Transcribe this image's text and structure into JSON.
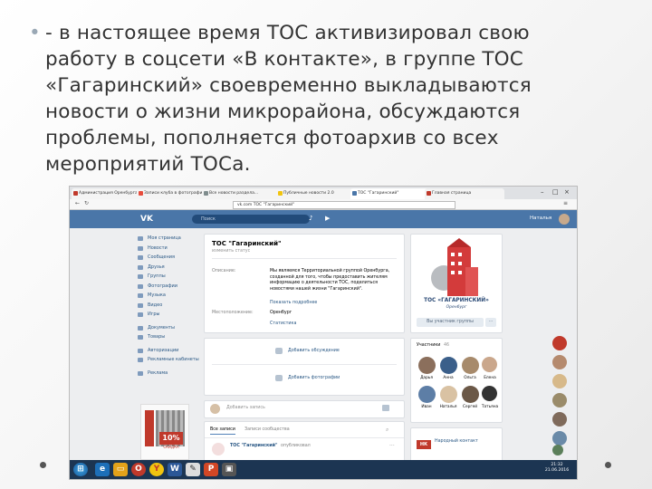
{
  "slide": {
    "bullet": "•",
    "text": "- в настоящее время ТОС активизировал свою работу в соцсети «В контакте», в группе ТОС «Гагаринский» своевременно выкладываются новости о жизни микрорайона, обсуждаются проблемы, пополняется фотоархив со всех мероприятий ТОСа."
  },
  "browser": {
    "tabs": [
      {
        "label": "Администрация Оренбурга",
        "color": "#c0392b"
      },
      {
        "label": "Записи клуба в фотографиях",
        "color": "#e74c3c"
      },
      {
        "label": "Все новости раздела...",
        "color": "#7f8c8d"
      },
      {
        "label": "Публичные новости 2.0",
        "color": "#f1c40f"
      },
      {
        "label": "ТОС \"Гагаринский\"",
        "color": "#4a76a8"
      },
      {
        "label": "Главная страница",
        "color": "#c0392b"
      }
    ],
    "address": "vk.com   ТОС \"Гагаринский\""
  },
  "vk": {
    "logo": "VK",
    "search_placeholder": "Поиск",
    "user_name": "Наталья",
    "nav": [
      "Моя страница",
      "Новости",
      "Сообщения",
      "Друзья",
      "Группы",
      "Фотографии",
      "Музыка",
      "Видео",
      "Игры",
      "",
      "Документы",
      "Товары",
      "",
      "Авторизации",
      "Рекламные кабинеты",
      "",
      "Реклама"
    ],
    "group_name": "ТОС \"Гагаринский\"",
    "group_status": "изменить статус",
    "info": [
      {
        "label": "Описание:",
        "value": "Мы являемся Территориальной группой Оренбурга, созданной для того, чтобы предоставить жителям информацию о деятельности ТОС, поделиться новостями нашей жизни \"Гагаринский\"."
      },
      {
        "label": "Местоположение:",
        "value": "Оренбург"
      }
    ],
    "more_link": "Показать подробнее",
    "stats_link": "Статистика",
    "add_discussion": "Добавить обсуждение",
    "add_photos": "Добавить фотографии",
    "members_title": "Участники",
    "members_count": "46",
    "member_names": [
      "Дарья",
      "Анна",
      "Ольга",
      "Елена",
      "Иван",
      "Наталья",
      "Сергей",
      "Татьяна"
    ],
    "invite_btn": "Вы участник группы",
    "post_placeholder": "Добавить запись",
    "wall_tabs": [
      "Все записи",
      "Записи сообщества"
    ],
    "post_author": "ТОС \"Гагаринский\"",
    "post_sub": "опубликовал",
    "logo_text": "ТОС «ГАГАРИНСКИЙ»",
    "logo_sub": "Оренбург",
    "promo": "10%",
    "promo_sub": "СКИДКА",
    "contacts_title": "Народный контакт",
    "clock_time": "21:32",
    "clock_date": "21.06.2016"
  }
}
